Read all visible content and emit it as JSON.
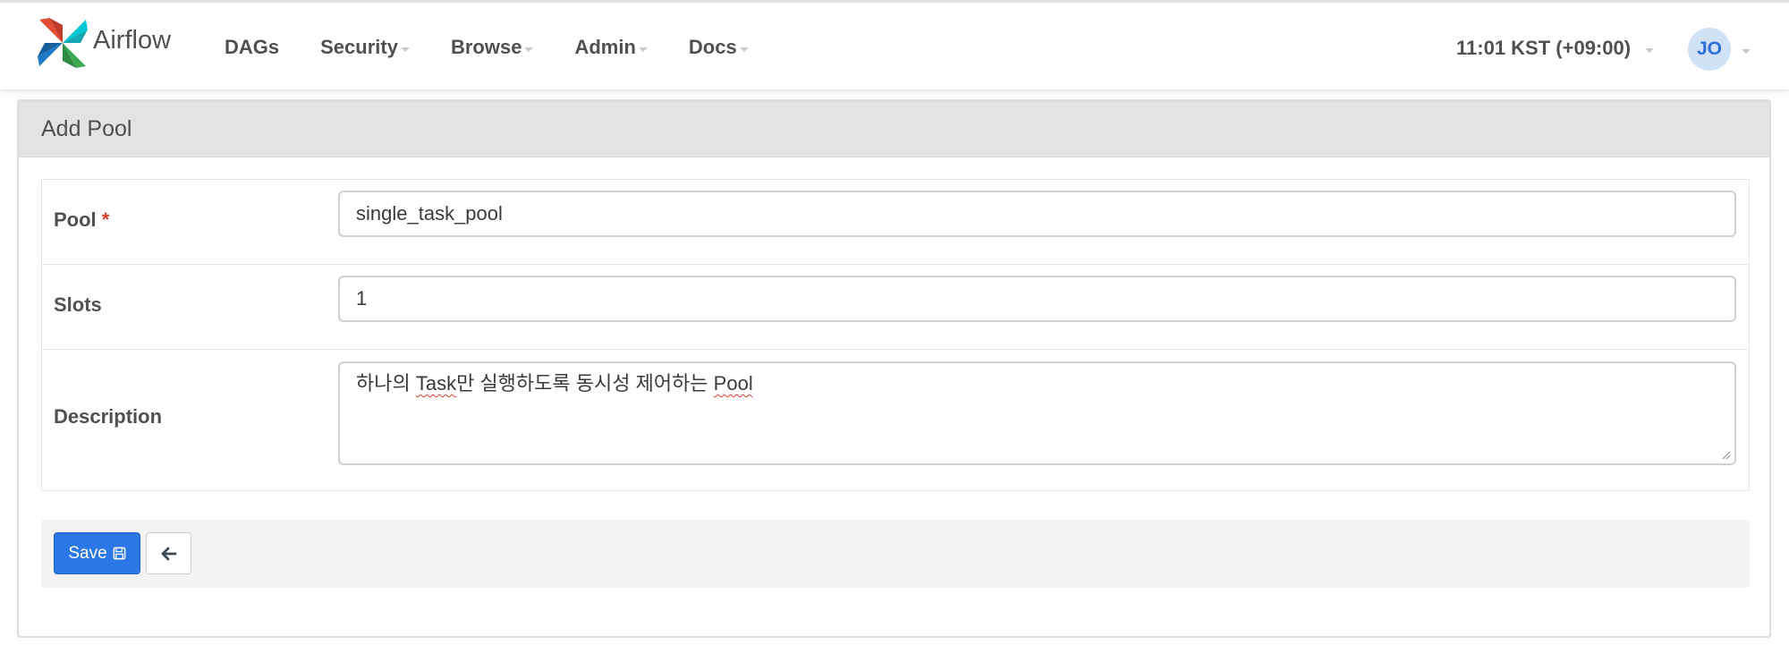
{
  "brand": {
    "name": "Airflow",
    "logo_icon": "airflow-pinwheel-icon"
  },
  "nav": {
    "items": [
      {
        "label": "DAGs",
        "dropdown": false
      },
      {
        "label": "Security",
        "dropdown": true
      },
      {
        "label": "Browse",
        "dropdown": true
      },
      {
        "label": "Admin",
        "dropdown": true
      },
      {
        "label": "Docs",
        "dropdown": true
      }
    ],
    "clock": "11:01 KST (+09:00)",
    "user_initials": "JO"
  },
  "panel": {
    "title": "Add Pool"
  },
  "form": {
    "pool": {
      "label": "Pool",
      "required_mark": "*",
      "value": "single_task_pool"
    },
    "slots": {
      "label": "Slots",
      "value": "1"
    },
    "description": {
      "label": "Description",
      "value_part1": "하나의 ",
      "value_word1": "Task",
      "value_part2": "만 실행하도록 동시성 제어하는 ",
      "value_word2": "Pool"
    }
  },
  "actions": {
    "save_label": "Save",
    "save_icon": "floppy-disk-icon",
    "back_icon": "arrow-left-icon"
  },
  "colors": {
    "primary": "#2b77e6",
    "required": "#e23b2e",
    "panel_heading": "#e3e3e3"
  }
}
